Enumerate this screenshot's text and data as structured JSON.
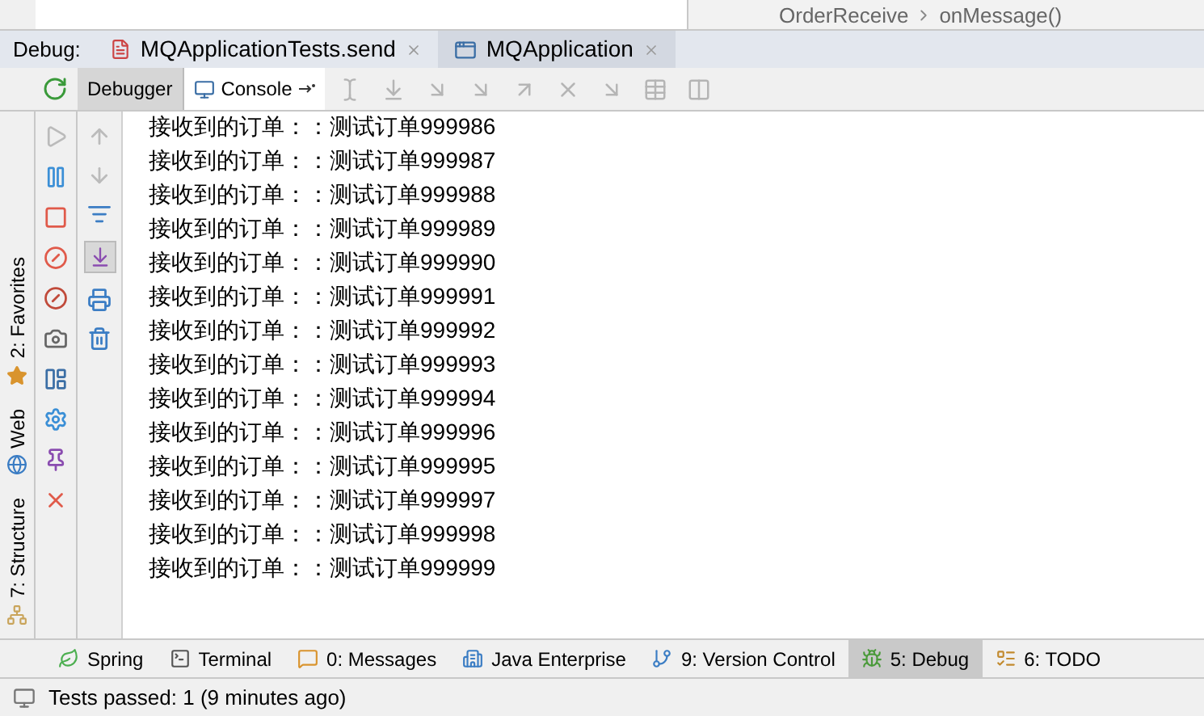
{
  "top": {
    "breadcrumb": [
      "OrderReceive",
      "onMessage()"
    ]
  },
  "debug": {
    "label": "Debug:",
    "tabs": [
      {
        "label": "MQApplicationTests.send",
        "selected": false
      },
      {
        "label": "MQApplication",
        "selected": true
      }
    ]
  },
  "subtabs": [
    {
      "label": "Debugger",
      "selected": false
    },
    {
      "label": "Console",
      "selected": true
    }
  ],
  "left_stripe": [
    {
      "label": "2: Favorites"
    },
    {
      "label": "Web"
    },
    {
      "label": "7: Structure"
    }
  ],
  "console_lines": [
    "接收到的订单：：测试订单999986",
    "接收到的订单：：测试订单999987",
    "接收到的订单：：测试订单999988",
    "接收到的订单：：测试订单999989",
    "接收到的订单：：测试订单999990",
    "接收到的订单：：测试订单999991",
    "接收到的订单：：测试订单999992",
    "接收到的订单：：测试订单999993",
    "接收到的订单：：测试订单999994",
    "接收到的订单：：测试订单999996",
    "接收到的订单：：测试订单999995",
    "接收到的订单：：测试订单999997",
    "接收到的订单：：测试订单999998",
    "接收到的订单：：测试订单999999"
  ],
  "tool_windows": [
    {
      "label": "Spring",
      "selected": false
    },
    {
      "label": "Terminal",
      "selected": false
    },
    {
      "label": "0: Messages",
      "selected": false
    },
    {
      "label": "Java Enterprise",
      "selected": false
    },
    {
      "label": "9: Version Control",
      "selected": false
    },
    {
      "label": "5: Debug",
      "selected": true
    },
    {
      "label": "6: TODO",
      "selected": false
    }
  ],
  "status": "Tests passed: 1 (9 minutes ago)"
}
